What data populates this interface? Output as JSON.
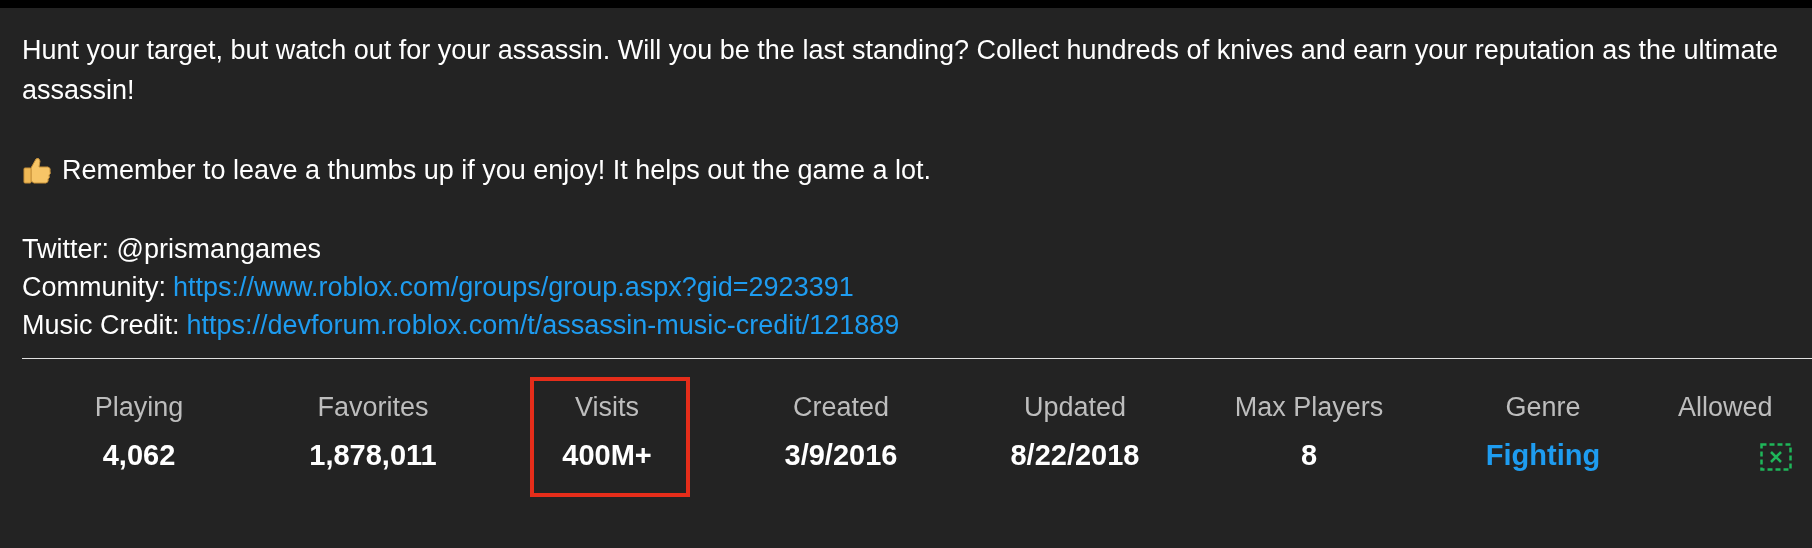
{
  "description": {
    "intro": "Hunt your target, but watch out for your assassin. Will you be the last standing? Collect hundreds of knives and earn your reputation as the ultimate assassin!",
    "tip": "Remember to leave a thumbs up if you enjoy! It helps out the game a lot.",
    "lines": [
      {
        "kind": "text",
        "text": "Twitter: @prismangames"
      },
      {
        "kind": "link",
        "label": "Community:",
        "url": "https://www.roblox.com/groups/group.aspx?gid=2923391"
      },
      {
        "kind": "link",
        "label": "Music Credit:",
        "url": "https://devforum.roblox.com/t/assassin-music-credit/121889"
      }
    ]
  },
  "stats": [
    {
      "label": "Playing",
      "kind": "text",
      "value": "4,062",
      "highlighted": false
    },
    {
      "label": "Favorites",
      "kind": "text",
      "value": "1,878,011",
      "highlighted": false
    },
    {
      "label": "Visits",
      "kind": "text",
      "value": "400M+",
      "highlighted": true
    },
    {
      "label": "Created",
      "kind": "text",
      "value": "3/9/2016",
      "highlighted": false
    },
    {
      "label": "Updated",
      "kind": "text",
      "value": "8/22/2018",
      "highlighted": false
    },
    {
      "label": "Max Players",
      "kind": "text",
      "value": "8",
      "highlighted": false
    },
    {
      "label": "Genre",
      "kind": "link",
      "value": "Fighting",
      "highlighted": false
    },
    {
      "label": "Allowed",
      "kind": "icon",
      "highlighted": false
    }
  ]
}
